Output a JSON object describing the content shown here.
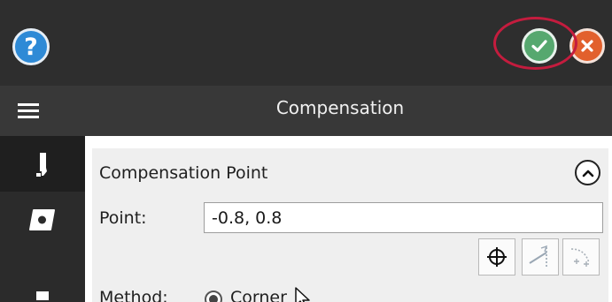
{
  "header": {
    "help_glyph": "?",
    "ok_icon": "check-circle-icon",
    "cancel_icon": "close-circle-icon",
    "title": "Compensation"
  },
  "sidebar": {
    "items": [
      {
        "icon": "tool-holder-icon",
        "active": true
      },
      {
        "icon": "insert-icon",
        "active": false
      },
      {
        "icon": "partial-icon",
        "active": false
      }
    ]
  },
  "section": {
    "title": "Compensation Point",
    "collapse_icon": "chevron-up-icon"
  },
  "point": {
    "label": "Point:",
    "value": "-0.8, 0.8"
  },
  "tools": [
    {
      "icon": "crosshair-icon"
    },
    {
      "icon": "angle-snap-icon"
    },
    {
      "icon": "corner-snap-icon"
    }
  ],
  "method": {
    "label": "Method:",
    "selected_option": "Corner"
  },
  "colors": {
    "topbar": "#2e2e2e",
    "titlebar": "#383838",
    "help": "#2e8ad6",
    "ok": "#56a86f",
    "cancel": "#e2602d",
    "highlight": "#c41c3e"
  }
}
